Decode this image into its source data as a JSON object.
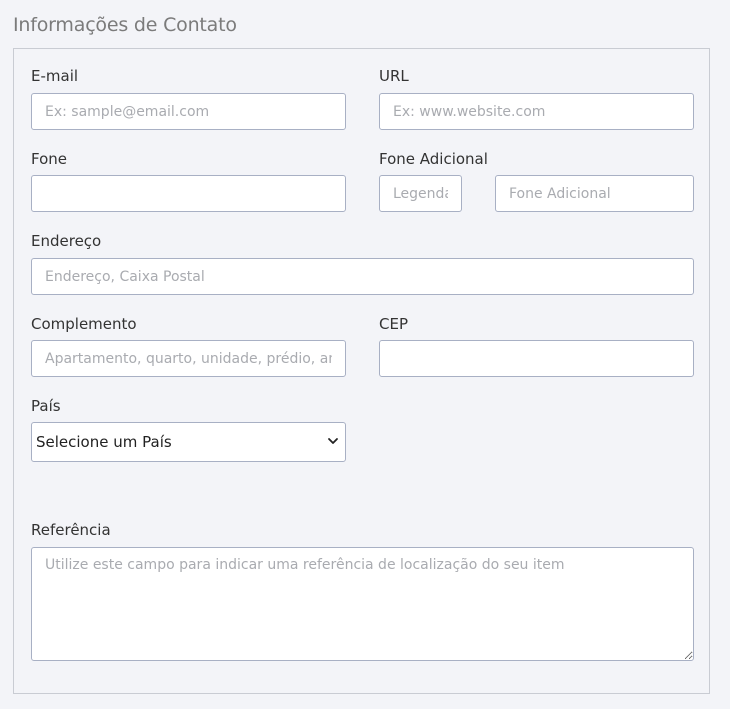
{
  "section": {
    "title": "Informações de Contato"
  },
  "email": {
    "label": "E-mail",
    "placeholder": "Ex: sample@email.com",
    "value": ""
  },
  "url": {
    "label": "URL",
    "placeholder": "Ex: www.website.com",
    "value": ""
  },
  "phone": {
    "label": "Fone",
    "placeholder": "",
    "value": ""
  },
  "extra_phone": {
    "label": "Fone Adicional",
    "caption_placeholder": "Legenda",
    "number_placeholder": "Fone Adicional"
  },
  "address": {
    "label": "Endereço",
    "placeholder": "Endereço, Caixa Postal"
  },
  "complement": {
    "label": "Complemento",
    "placeholder": "Apartamento, quarto, unidade, prédio, andar, etc."
  },
  "cep": {
    "label": "CEP",
    "placeholder": ""
  },
  "country": {
    "label": "País",
    "selected": "Selecione um País",
    "icon": "chevron-down-icon"
  },
  "reference": {
    "label": "Referência",
    "placeholder": "Utilize este campo para indicar uma referência de localização do seu item"
  },
  "colors": {
    "background": "#f3f4f8",
    "border": "#a8b0c4",
    "title": "#7b7b7b",
    "label": "#333333",
    "placeholder": "#a9abb0"
  }
}
